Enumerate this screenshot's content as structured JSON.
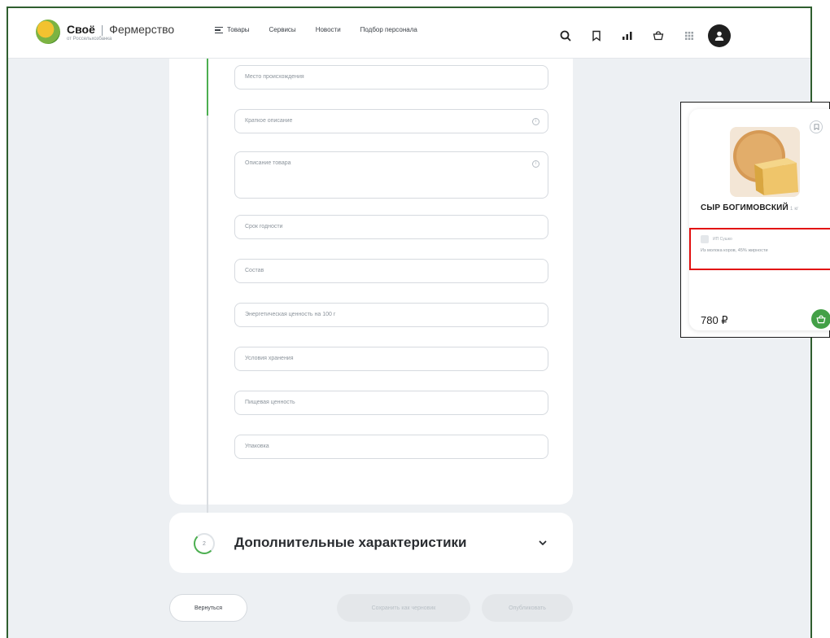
{
  "header": {
    "brand": "Своё",
    "brand_separator": "|",
    "brand_product": "Фермерство",
    "brand_tagline": "от Россельхозбанка",
    "nav": [
      {
        "label": "Товары",
        "icon": "menu-icon"
      },
      {
        "label": "Сервисы"
      },
      {
        "label": "Новости"
      },
      {
        "label": "Подбор персонала"
      }
    ],
    "icons": [
      "search-icon",
      "bookmark-icon",
      "chart-icon",
      "basket-icon",
      "grid-icon",
      "user-avatar-icon"
    ]
  },
  "form": {
    "fields": [
      {
        "placeholder": "Место происхождения"
      },
      {
        "placeholder": "Краткое описание",
        "info": "i"
      },
      {
        "placeholder": "Описание товара",
        "info": "i"
      },
      {
        "placeholder": "Срок годности"
      },
      {
        "placeholder": "Состав"
      },
      {
        "placeholder": "Энергетическая ценность на 100 г"
      },
      {
        "placeholder": "Условия хранения"
      },
      {
        "placeholder": "Пищевая ценность"
      },
      {
        "placeholder": "Упаковка"
      }
    ]
  },
  "extra": {
    "step": "2",
    "title": "Дополнительные характеристики"
  },
  "buttons": {
    "back": "Вернуться",
    "draft": "Сохранить как черновик",
    "publish": "Опубликовать"
  },
  "preview": {
    "name": "СЫР БОГИМОВСКИЙ",
    "weight": "1 кг",
    "seller": "ИП Сушко",
    "description": "Из молока коров, 45% жирности",
    "price": "780 ₽",
    "colors": {
      "accent": "#43a047",
      "highlight": "#e20f0f"
    }
  }
}
